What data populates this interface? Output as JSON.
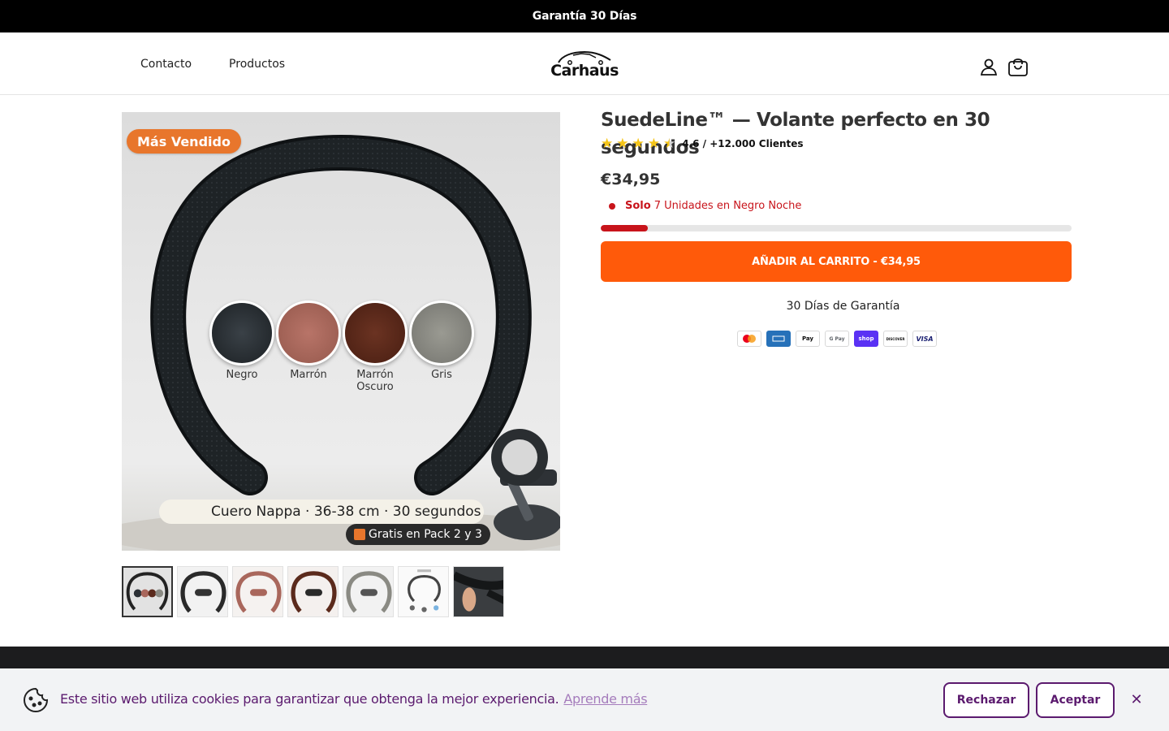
{
  "announcement": {
    "text": "Garantía 30 Días"
  },
  "header": {
    "nav": [
      {
        "label": "Contacto"
      },
      {
        "label": "Productos"
      }
    ],
    "logo_text": "Carhaus"
  },
  "gallery": {
    "badge": "Más Vendido",
    "swatches": [
      {
        "label": "Negro",
        "color": "#2b3035"
      },
      {
        "label": "Marrón",
        "color": "#a9675c"
      },
      {
        "label": "Marrón Oscuro",
        "color": "#5b2a1c"
      },
      {
        "label": "Gris",
        "color": "#8a8a83"
      }
    ],
    "caption": "Cuero Nappa · 36-38 cm · 30 segundos",
    "gratis": "Gratis en Pack 2 y 3",
    "thumbnail_count": 7
  },
  "product": {
    "title": "SuedeLine™ — Volante perfecto en 30 segundos",
    "rating_value": 4.6,
    "rating_text": "4.6 / +12.000 Clientes",
    "price": "€34,95",
    "stock_label": "Solo",
    "stock_text": "7 Unidades en Negro Noche",
    "stock_fraction": 0.1,
    "add_to_cart": "AÑADIR AL CARRITO - €34,95",
    "guarantee": "30 Días de Garantía",
    "accent_color": "#ff5a0a",
    "payments": [
      {
        "name": "mastercard-icon"
      },
      {
        "name": "amex-icon"
      },
      {
        "name": "applepay-icon",
        "label": "Pay"
      },
      {
        "name": "googlepay-icon",
        "label": "G Pay"
      },
      {
        "name": "shoppay-icon",
        "label": "shop"
      },
      {
        "name": "discover-icon",
        "label": "DISCOVER"
      },
      {
        "name": "visa-icon",
        "label": "VISA"
      }
    ]
  },
  "cookie": {
    "text": "Este sitio web utiliza cookies para garantizar que obtenga la mejor experiencia.",
    "link": "Aprende más",
    "reject": "Rechazar",
    "accept": "Aceptar"
  }
}
